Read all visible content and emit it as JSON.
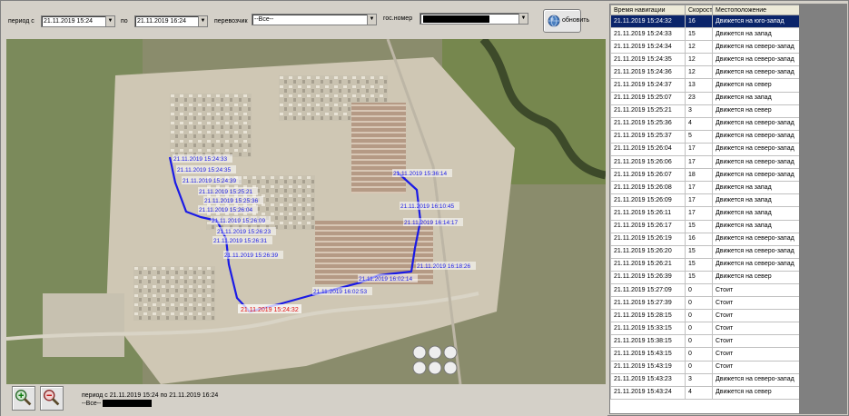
{
  "filters": {
    "period_from_label": "период с",
    "period_from_value": "21.11.2019 15:24",
    "period_to_label": "по",
    "period_to_value": "21.11.2019 16:24",
    "carrier_label": "перевозчик",
    "carrier_value": "--Все--",
    "plate_label": "гос.номер",
    "refresh_label": "обновить"
  },
  "map": {
    "track_labels": [
      "21.11.2019 15:24:33",
      "21.11.2019 15:24:35",
      "21.11.2019 15:24:39",
      "21.11.2019 15:25:21",
      "21.11.2019 15:25:36",
      "21.11.2019 15:26:04",
      "21.11.2019 15:26:09",
      "21.11.2019 15:26:23",
      "21.11.2019 15:26:31",
      "21.11.2019 15:26:39",
      "21.11.2019 15:36:14",
      "21.11.2019 16:10:45",
      "21.11.2019 16:14:17",
      "21.11.2019 16:18:26",
      "21.11.2019 16:02:14",
      "21.11.2019 16:02:53"
    ],
    "current_label": "21.11.2019 15:24:32"
  },
  "summary": {
    "period_text": "период с 21.11.2019 15:24 по 21.11.2019 16:24",
    "carrier_text": "--Все--"
  },
  "table": {
    "headers": [
      "Время навигации",
      "Скорость",
      "Местоположение"
    ],
    "rows": [
      [
        "21.11.2019 15:24:32",
        "16",
        "Движется на юго-запад"
      ],
      [
        "21.11.2019 15:24:33",
        "15",
        "Движется на запад"
      ],
      [
        "21.11.2019 15:24:34",
        "12",
        "Движется на северо-запад"
      ],
      [
        "21.11.2019 15:24:35",
        "12",
        "Движется на северо-запад"
      ],
      [
        "21.11.2019 15:24:36",
        "12",
        "Движется на северо-запад"
      ],
      [
        "21.11.2019 15:24:37",
        "13",
        "Движется на север"
      ],
      [
        "21.11.2019 15:25:07",
        "23",
        "Движется на запад"
      ],
      [
        "21.11.2019 15:25:21",
        "3",
        "Движется на север"
      ],
      [
        "21.11.2019 15:25:36",
        "4",
        "Движется на северо-запад"
      ],
      [
        "21.11.2019 15:25:37",
        "5",
        "Движется на северо-запад"
      ],
      [
        "21.11.2019 15:26:04",
        "17",
        "Движется на северо-запад"
      ],
      [
        "21.11.2019 15:26:06",
        "17",
        "Движется на северо-запад"
      ],
      [
        "21.11.2019 15:26:07",
        "18",
        "Движется на северо-запад"
      ],
      [
        "21.11.2019 15:26:08",
        "17",
        "Движется на запад"
      ],
      [
        "21.11.2019 15:26:09",
        "17",
        "Движется на запад"
      ],
      [
        "21.11.2019 15:26:11",
        "17",
        "Движется на запад"
      ],
      [
        "21.11.2019 15:26:17",
        "15",
        "Движется на запад"
      ],
      [
        "21.11.2019 15:26:19",
        "16",
        "Движется на северо-запад"
      ],
      [
        "21.11.2019 15:26:20",
        "15",
        "Движется на северо-запад"
      ],
      [
        "21.11.2019 15:26:21",
        "15",
        "Движется на северо-запад"
      ],
      [
        "21.11.2019 15:26:39",
        "15",
        "Движется на север"
      ],
      [
        "21.11.2019 15:27:09",
        "0",
        "Стоит"
      ],
      [
        "21.11.2019 15:27:39",
        "0",
        "Стоит"
      ],
      [
        "21.11.2019 15:28:15",
        "0",
        "Стоит"
      ],
      [
        "21.11.2019 15:33:15",
        "0",
        "Стоит"
      ],
      [
        "21.11.2019 15:38:15",
        "0",
        "Стоит"
      ],
      [
        "21.11.2019 15:43:15",
        "0",
        "Стоит"
      ],
      [
        "21.11.2019 15:43:19",
        "0",
        "Стоит"
      ],
      [
        "21.11.2019 15:43:23",
        "3",
        "Движется на северо-запад"
      ],
      [
        "21.11.2019 15:43:24",
        "4",
        "Движется на север"
      ]
    ]
  },
  "colors": {
    "selected_row": "#0a246a",
    "track": "#1a1ae6",
    "current_marker": "#e01010",
    "panel": "#d4d0c8"
  },
  "icons": {
    "refresh": "globe-icon",
    "zoom_in": "zoom-in-icon",
    "zoom_out": "zoom-out-icon",
    "dropdown": "chevron-down-icon"
  }
}
